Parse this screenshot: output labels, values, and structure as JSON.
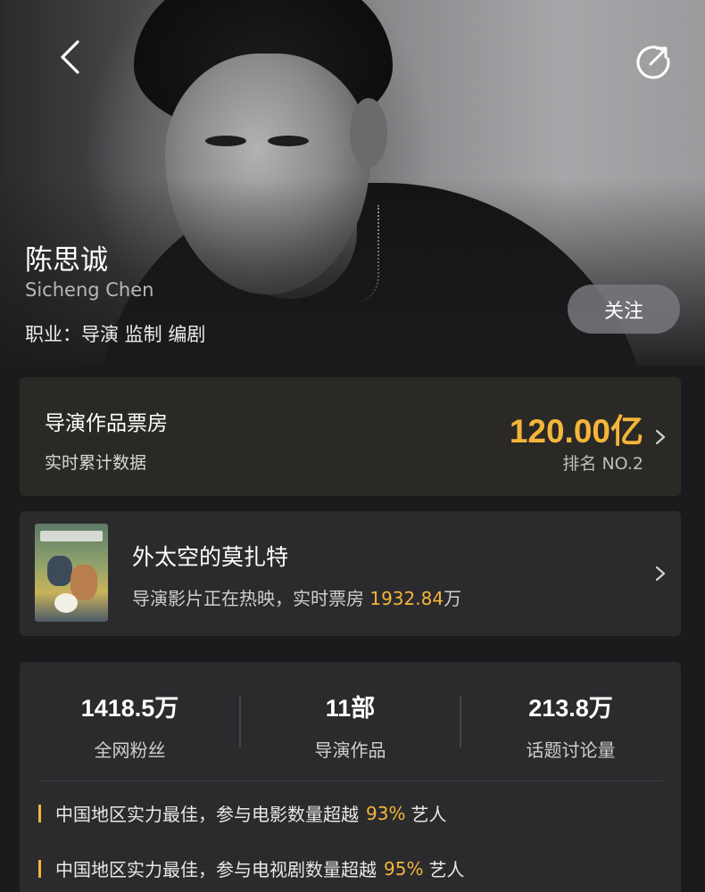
{
  "profile": {
    "name": "陈思诚",
    "name_en": "Sicheng Chen",
    "job_label": "职业：",
    "job_value": "导演 监制 编剧",
    "follow_label": "关注"
  },
  "header": {
    "back_icon": "chevron-left-icon",
    "share_icon": "share-icon"
  },
  "box_office": {
    "title": "导演作品票房",
    "subtitle": "实时累计数据",
    "amount": "120.00亿",
    "rank": "排名 NO.2"
  },
  "now_showing": {
    "movie_title": "外太空的莫扎特",
    "desc_prefix": "导演影片正在热映，实时票房",
    "box_office": "1932.84",
    "unit": "万"
  },
  "stats": [
    {
      "value": "1418.5万",
      "label": "全网粉丝"
    },
    {
      "value": "11部",
      "label": "导演作品"
    },
    {
      "value": "213.8万",
      "label": "话题讨论量"
    }
  ],
  "facts": [
    {
      "prefix": "中国地区实力最佳，参与电影数量超越",
      "percent": "93%",
      "suffix": "艺人"
    },
    {
      "prefix": "中国地区实力最佳，参与电视剧数量超越",
      "percent": "95%",
      "suffix": "艺人"
    }
  ],
  "colors": {
    "accent": "#f3b53a",
    "background": "#1b1b1d",
    "card": "#2b2b2e",
    "box_office_card": "#2b2925"
  }
}
